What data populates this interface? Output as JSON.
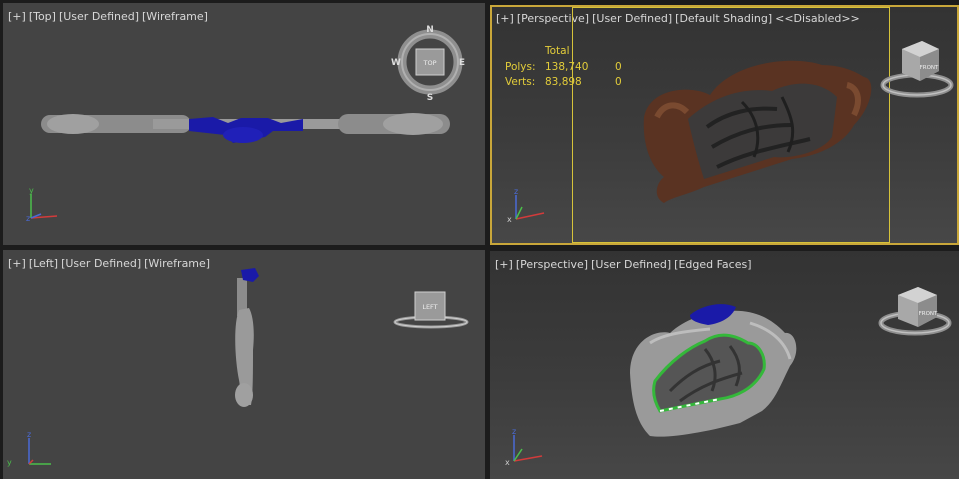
{
  "viewports": {
    "top": {
      "labels": [
        "[+]",
        "[Top]",
        "[User Defined]",
        "[Wireframe]"
      ],
      "compass": {
        "n": "N",
        "s": "S",
        "e": "E",
        "w": "W",
        "cube_face": "TOP"
      }
    },
    "perspective_shaded": {
      "labels": [
        "[+]",
        "[Perspective]",
        "[User Defined]",
        "[Default Shading]",
        "<<Disabled>>"
      ],
      "stats": {
        "header": "Total",
        "polys_label": "Polys:",
        "polys_value": "138,740",
        "polys_selected": "0",
        "verts_label": "Verts:",
        "verts_value": "83,898",
        "verts_selected": "0"
      },
      "cube_face": "FRONT"
    },
    "left": {
      "labels": [
        "[+]",
        "[Left]",
        "[User Defined]",
        "[Wireframe]"
      ],
      "cube_face": "LEFT"
    },
    "perspective_edged": {
      "labels": [
        "[+]",
        "[Perspective]",
        "[User Defined]",
        "[Edged Faces]"
      ],
      "cube_face": "FRONT"
    }
  },
  "axes": {
    "x": "x",
    "y": "y",
    "z": "z"
  },
  "colors": {
    "active_border": "#c9a73a",
    "stats_text": "#e3cd3a",
    "selection_blue": "#1a1aa8",
    "wood_brown": "#5a3322",
    "selection_green": "#34b83a"
  }
}
